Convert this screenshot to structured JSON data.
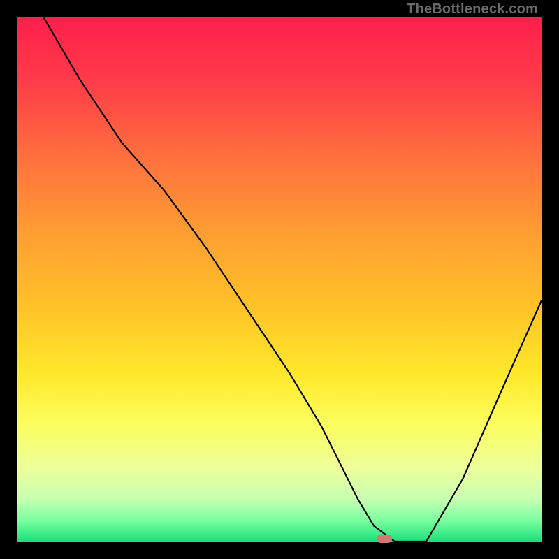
{
  "watermark": {
    "text": "TheBottleneck.com"
  },
  "marker": {
    "color_hex": "#cf7a72"
  },
  "gradient": {
    "stops": [
      {
        "pct": 0,
        "hex": "#ff1f4c"
      },
      {
        "pct": 12,
        "hex": "#ff3b49"
      },
      {
        "pct": 25,
        "hex": "#ff6a3f"
      },
      {
        "pct": 40,
        "hex": "#ff9a33"
      },
      {
        "pct": 55,
        "hex": "#ffc228"
      },
      {
        "pct": 68,
        "hex": "#ffe82a"
      },
      {
        "pct": 78,
        "hex": "#fbff60"
      },
      {
        "pct": 86,
        "hex": "#edff9a"
      },
      {
        "pct": 92,
        "hex": "#c6ffb2"
      },
      {
        "pct": 96,
        "hex": "#7aff9f"
      },
      {
        "pct": 100,
        "hex": "#18e07a"
      }
    ]
  },
  "chart_data": {
    "type": "line",
    "title": "",
    "xlabel": "",
    "ylabel": "",
    "xlim": [
      0,
      100
    ],
    "ylim": [
      0,
      100
    ],
    "curve": {
      "x": [
        5,
        12,
        20,
        28,
        36,
        44,
        52,
        58,
        62,
        65,
        68,
        72,
        78,
        85,
        92,
        100
      ],
      "y": [
        100,
        88,
        76,
        67,
        56,
        44,
        32,
        22,
        14,
        8,
        3,
        0,
        0,
        12,
        28,
        46
      ]
    },
    "optimum": {
      "x": 70,
      "y": 0
    },
    "annotations": [
      "TheBottleneck.com"
    ]
  }
}
